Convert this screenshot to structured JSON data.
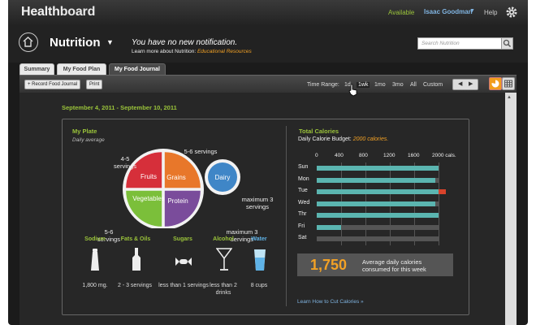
{
  "app": {
    "logo_prefix": "Health",
    "logo_suffix": "board"
  },
  "topbar": {
    "status": "Available",
    "user": "Isaac Goodman",
    "user_caret": "▼",
    "help": "Help"
  },
  "header": {
    "title": "Nutrition",
    "title_caret": "▼",
    "notification": "You have no new notification.",
    "learn_more_prefix": "Learn more about Nutrition: ",
    "learn_more_link": "Educational Resources",
    "search_placeholder": "Search Nutrition"
  },
  "tabs": [
    {
      "label": "Summary",
      "active": false
    },
    {
      "label": "My Food Plan",
      "active": false
    },
    {
      "label": "My Food Journal",
      "active": true
    }
  ],
  "toolbar": {
    "record_button": "+ Record Food Journal",
    "print_button": "Print",
    "time_range_label": "Time Range:",
    "range_options": [
      "1d",
      "1wk",
      "1mo",
      "3mo",
      "All",
      "Custom"
    ],
    "selected_range": "1wk",
    "prev": "◀",
    "next": "▶"
  },
  "date_range": "September 4, 2011 - September 10, 2011",
  "my_plate": {
    "title": "My Plate",
    "subtitle": "Daily average",
    "segments": [
      {
        "label": "Fruits",
        "color": "#d62f3a"
      },
      {
        "label": "Grains",
        "color": "#e8772a"
      },
      {
        "label": "Vegetables",
        "color": "#7bbf3a"
      },
      {
        "label": "Protein",
        "color": "#7a4c9b"
      }
    ],
    "dairy": {
      "label": "Dairy",
      "color": "#3f86c7"
    },
    "label_fruits": "4-5 servings",
    "label_grains": "5-6 servings",
    "label_dairy": "maximum 3 servings",
    "label_vegetables": "5-6 servings",
    "label_protein": "maximum 3 servings"
  },
  "nutrients": [
    {
      "name": "Sodium",
      "value": "1,800 mg."
    },
    {
      "name": "Fats & Oils",
      "value": "2 - 3 servings"
    },
    {
      "name": "Sugars",
      "value": "less than 1 servings"
    },
    {
      "name": "Alcohol",
      "value": "less than 2 drinks"
    },
    {
      "name": "Water",
      "value": "8 cups"
    }
  ],
  "calories": {
    "title": "Total Calories",
    "budget_prefix": "Daily Calorie Budget: ",
    "budget_value": "2000 calories.",
    "avg_value": "1,750",
    "avg_text_1": "Average daily calories",
    "avg_text_2": "consumed for this week",
    "cut_link": "Learn How to Cut Calories  »",
    "colors": {
      "fill": "#5bb5b0",
      "over": "#d9432b",
      "track": "#555555"
    }
  },
  "chart_data": {
    "type": "bar",
    "orientation": "horizontal",
    "title": "Total Calories",
    "categories": [
      "Sun",
      "Mon",
      "Tue",
      "Wed",
      "Thr",
      "Fri",
      "Sat"
    ],
    "values": [
      2000,
      1950,
      2120,
      1950,
      2000,
      400,
      0
    ],
    "budget": 2000,
    "xlim": [
      0,
      2000
    ],
    "xticks": [
      "0",
      "400",
      "800",
      "1200",
      "1600",
      "2000 cals."
    ],
    "grid": true
  }
}
